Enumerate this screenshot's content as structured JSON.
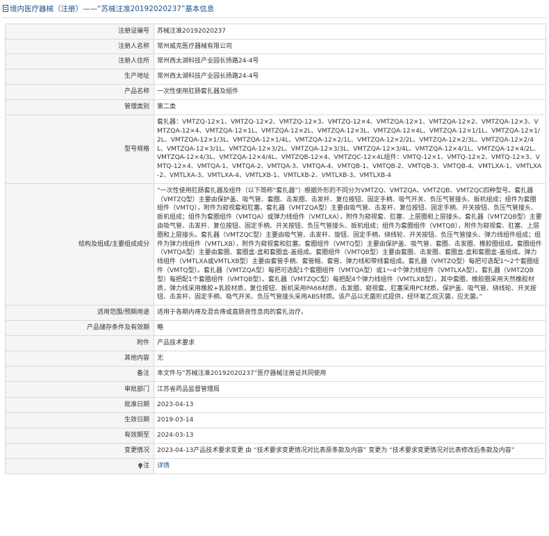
{
  "header": {
    "title": "境内医疗器械（注册）——“苏械注准20192020237”基本信息"
  },
  "rows": [
    {
      "label": "注册证编号",
      "value": "苏械注准20192020237"
    },
    {
      "label": "注册人名称",
      "value": "常州威克医疗器械有限公司"
    },
    {
      "label": "注册人住所",
      "value": "常州西太湖科技产业园长扬路24-4号"
    },
    {
      "label": "生产地址",
      "value": "常州西太湖科技产业园长扬路24-4号"
    },
    {
      "label": "产品名称",
      "value": "一次性使用肛肠套扎器及组件"
    },
    {
      "label": "管理类别",
      "value": "第二类"
    },
    {
      "label": "型号规格",
      "value": "套扎器：VMTZQ-12×1、VMTZQ-12×2、VMTZQ-12×3、VMTZQ-12×4、VMTZQA-12×1、VMTZQA-12×2、VMTZQA-12×3、VMTZQA-12×4、VMTZQA-12×1L、VMTZQA-12×2L、VMTZQA-12×3L、VMTZQA-12×4L、VMTZQA-12×1/1L、VMTZQA-12×1/2L、VMTZQA-12×1/3L、VMTZQA-12×1/4L、VMTZQA-12×2/1L、VMTZQA-12×2/2L、VMTZQA-12×2/3L、VMTZQA-12×2/4L、VMTZQA-12×3/1L、VMTZQA-12×3/2L、VMTZQA-12×3/3L、VMTZQA-12×3/4L、VMTZQA-12×4/1L、VMTZQA-12×4/2L、VMTZQA-12×4/3L、VMTZQA-12×4/4L、VMTZQB-12×4、VMTZQC-12×4L组件：VMTQ-12×1、VMTQ-12×2、VMTQ-12×3、VMTQ-12×4、VMTQA-1、VMTQA-2、VMTQA-3、VMTQA-4、VMTQB-1、VMTQB-2、VMTQB-3、VMTQB-4、VMTLXA-1、VMTLXA-2、VMTLXA-3、VMTLXA-4、VMTLXB-1、VMTLXB-2、VMTLXB-3、VMTLXB-4"
    },
    {
      "label": "结构及组成/主要组成成分",
      "value": "“一次性使用肛肠套扎器及组件（以下简称“套扎器”）根据外形的不同分为VMTZQ、VMTZQA、VMTZQB、VMTZQC四种型号。套扎器（VMTZQ型）主要由保护盖、吸气管、套圈、击发圈、击发杆、复位按钮、固定手柄、吸气开关、负压气管接头、扳机组成；组件为套圈组件（VMTQ），附件为窥视套和肛塞。套扎器（VMTZQA型）主要由吸气管、击发杆、复位按钮、固定手柄、开关按钮、负压气管接头、扳机组成；组件为套圈组件（VMTQA）或弹力线组件（VMTLXA），附件为窥视套、肛塞、上层圈和上层接头。套扎器（VMTZQB型）主要由吸气管、击发杆、复位按钮、固定手柄、开关按钮、负压气管接头、扳机组成；组件为套圈组件（VMTQB），附件为窥视套、肛塞、上层圈和上层接头。套扎器（VMTZQC型）主要由吸气管、击发杆、旋钮、固定手柄、绕线轮、开关按钮、负压气管接头、弹力线组件组成；组件为弹力线组件（VMTLXB），附件为窥视套和肛塞。套圈组件（VMTQ型）主要由保护盖、吸气管、套圈、击发圈、橡胶圈组成。套圈组件（VMTQA型）主要由套圈、套圈盒-盒和套圈盒-盖组成。套圈组件（VMTQB型）主要由套圈、击发圈、套圈盒-盒和套圈盒-盖组成。弹力线组件（VMTLXA或VMTLXB型）主要由套管手柄、套管帽、套管、弹力线和带线套组成。套扎器（VMTZQ型）每把可选配1～2个套圈组件（VMTQ型）。套扎器（VMTZQA型）每把可选配1个套圈组件（VMTQA型）或1～4个弹力线组件（VMTLXA型）。套扎器（VMTZQB型）每把配1个套圈组件（VMTQB型）。套扎器（VMTZQC型）每把配4个弹力线组件（VMTLXB型）。其中套圈、橡胶圈采用天然橡胶材质，弹力线采用橡胶+乳胶材质，复位按钮、扳机采用PA66材质，击发圈、窥视套、肛塞采用PC材质，保护盖、吸气管、绕线轮、开关按钮、击发杆、固定手柄、吸气开关、负压气管接头采用ABS材质。该产品以无菌形式提供，经环氧乙烷灭菌，应无菌。”"
    },
    {
      "label": "适用范围/预期用途",
      "value": "适用于各期内痔及混合痔或直肠良性息肉的套扎治疗。"
    },
    {
      "label": "产品储存条件及有效期",
      "value": "略"
    },
    {
      "label": "附件",
      "value": "产品技术要求"
    },
    {
      "label": "其他内容",
      "value": "无"
    },
    {
      "label": "备注",
      "value": "本文件与“苏械注准20192020237”医疗器械注册证共同使用"
    },
    {
      "label": "审批部门",
      "value": "江苏省药品监督管理局"
    },
    {
      "label": "批准日期",
      "value": "2023-04-13"
    },
    {
      "label": "生效日期",
      "value": "2019-03-14"
    },
    {
      "label": "有效期至",
      "value": "2024-03-13"
    },
    {
      "label": "变更情况",
      "value": "2023-04-13产品技术要求变更 由 “技术要求变更情况对比表原条款及内容” 变更为 “技术要求变更情况对比表修改后条款及内容”"
    }
  ],
  "note": {
    "label": "注",
    "icon": "lightbulb-icon",
    "link_text": "详情"
  }
}
